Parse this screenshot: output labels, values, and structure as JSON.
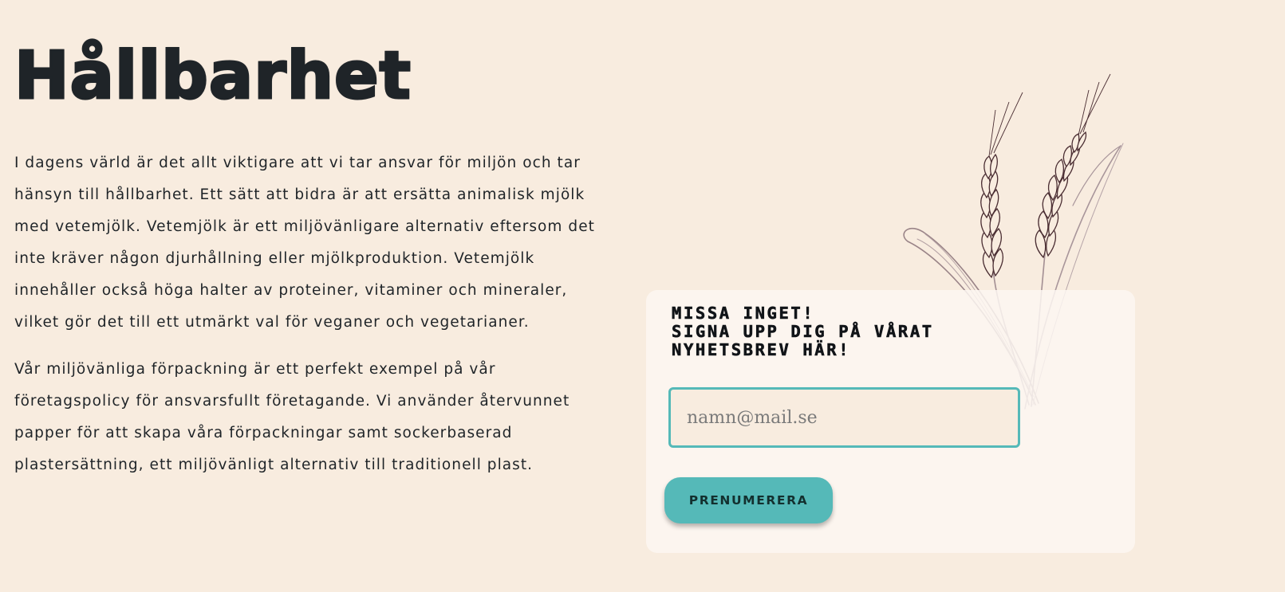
{
  "heading": "Hållbarhet",
  "paragraphs": [
    "I dagens värld är det allt viktigare att vi tar ansvar för miljön och tar hänsyn till hållbarhet. Ett sätt att bidra är att ersätta animalisk mjölk med vetemjölk. Vetemjölk är ett miljövänligare alternativ eftersom det inte kräver någon djurhållning eller mjölkproduktion. Vetemjölk innehåller också höga halter av proteiner, vitaminer och mineraler, vilket gör det till ett utmärkt val för veganer och vegetarianer.",
    "Vår miljövänliga förpackning är ett perfekt exempel på vår företagspolicy för ansvarsfullt företagande. Vi använder återvunnet papper för att skapa våra förpackningar samt sockerbaserad plastersättning, ett miljövänligt alternativ till traditionell plast."
  ],
  "newsletter": {
    "title_lines": [
      "MISSA INGET!",
      "SIGNA UPP DIG PÅ VÅRAT",
      "NYHETSBREV HÄR!"
    ],
    "email_placeholder": "namn@mail.se",
    "email_value": "",
    "button_label": "PRENUMERERA"
  },
  "decoration": {
    "icon": "wheat-illustration"
  },
  "colors": {
    "background": "#f8ecdf",
    "accent": "#55b9b8",
    "text": "#1f2428",
    "wheat": "#4a2d32"
  }
}
